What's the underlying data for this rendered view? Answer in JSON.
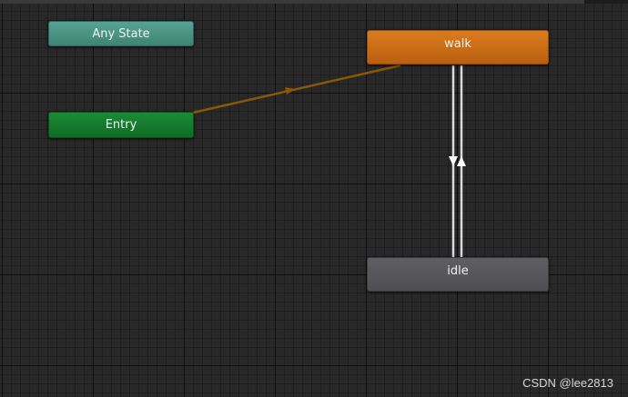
{
  "states": {
    "any_state": {
      "label": "Any State",
      "color": "#4a9385"
    },
    "entry": {
      "label": "Entry",
      "color": "#16792e"
    },
    "walk": {
      "label": "walk",
      "color": "#c96c16"
    },
    "idle": {
      "label": "idle",
      "color": "#57575b"
    }
  },
  "transitions": [
    {
      "from": "Entry",
      "to": "walk",
      "color": "#8a5608"
    },
    {
      "from": "walk",
      "to": "idle",
      "color": "#d9d9d9"
    },
    {
      "from": "idle",
      "to": "walk",
      "color": "#d9d9d9"
    }
  ],
  "watermark": "CSDN @lee2813"
}
